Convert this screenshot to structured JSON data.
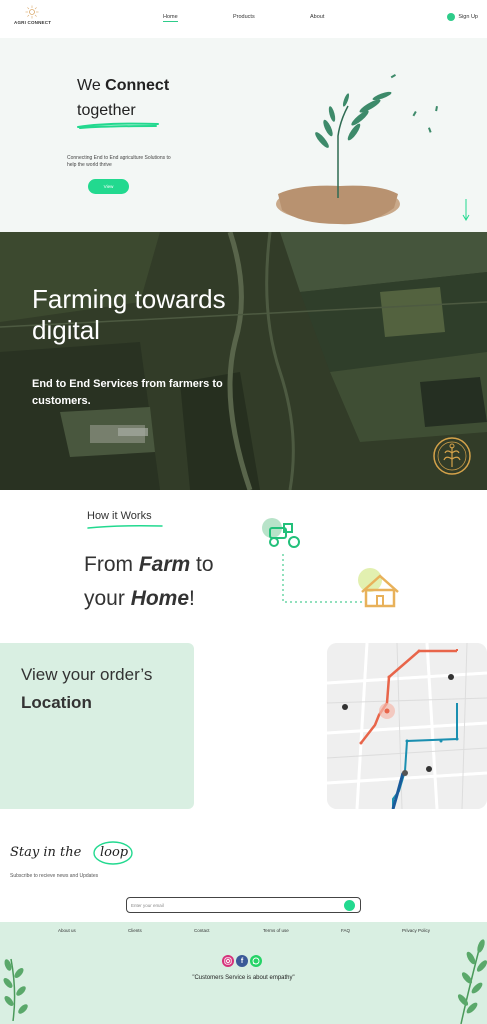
{
  "brand": {
    "name": "AGRI CONNECT",
    "accent": "#22d98f"
  },
  "nav": {
    "links": [
      "Home",
      "Products",
      "About"
    ],
    "signup": "Sign Up"
  },
  "hero": {
    "line1_prefix": "We ",
    "line1_bold": "Connect",
    "line2": "together",
    "description": "Connecting End to End agriculture Solutions to help the world thrive",
    "button": "View"
  },
  "farming": {
    "title": "Farming towards digital",
    "subtitle": "End to End Services from farmers to customers."
  },
  "how": {
    "label": "How it Works",
    "line1_pre": "From ",
    "line1_bold": "Farm",
    "line1_post": " to",
    "line2_pre": "your ",
    "line2_bold": "Home",
    "line2_post": "!"
  },
  "location": {
    "line1": "View your order’s",
    "line2": "Location"
  },
  "loop": {
    "title_pre": "Stay in the",
    "title_circled": "loop",
    "description": "Subscribe to recieve news and Updates",
    "email_placeholder": "Enter your email"
  },
  "footer": {
    "links": [
      "About us",
      "Clients",
      "Contact",
      "Terms of use",
      "FAQ",
      "Privacy Policy"
    ],
    "socials": [
      "instagram-icon",
      "facebook-icon",
      "whatsapp-icon"
    ],
    "quote": "\"Customers Service is about empathy\""
  }
}
